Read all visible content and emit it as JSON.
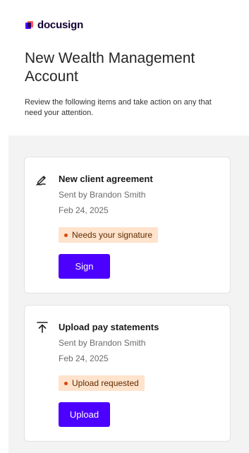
{
  "brand": {
    "name": "docusign",
    "colors": {
      "purple": "#4c00ff",
      "coral": "#ff5252",
      "ink": "#130032"
    }
  },
  "header": {
    "title": "New Wealth Management Account",
    "subtitle": "Review the following items and take action on any that need your attention."
  },
  "items": [
    {
      "icon": "pen-sign-icon",
      "title": "New client agreement",
      "sender": "Sent by Brandon Smith",
      "date": "Feb 24, 2025",
      "status": "Needs your signature",
      "action_label": "Sign"
    },
    {
      "icon": "upload-arrow-icon",
      "title": "Upload pay statements",
      "sender": "Sent by Brandon Smith",
      "date": "Feb 24, 2025",
      "status": "Upload requested",
      "action_label": "Upload"
    }
  ],
  "colors": {
    "badge_bg": "#ffe3cc",
    "badge_dot": "#d9480f",
    "button": "#4c00ff"
  }
}
